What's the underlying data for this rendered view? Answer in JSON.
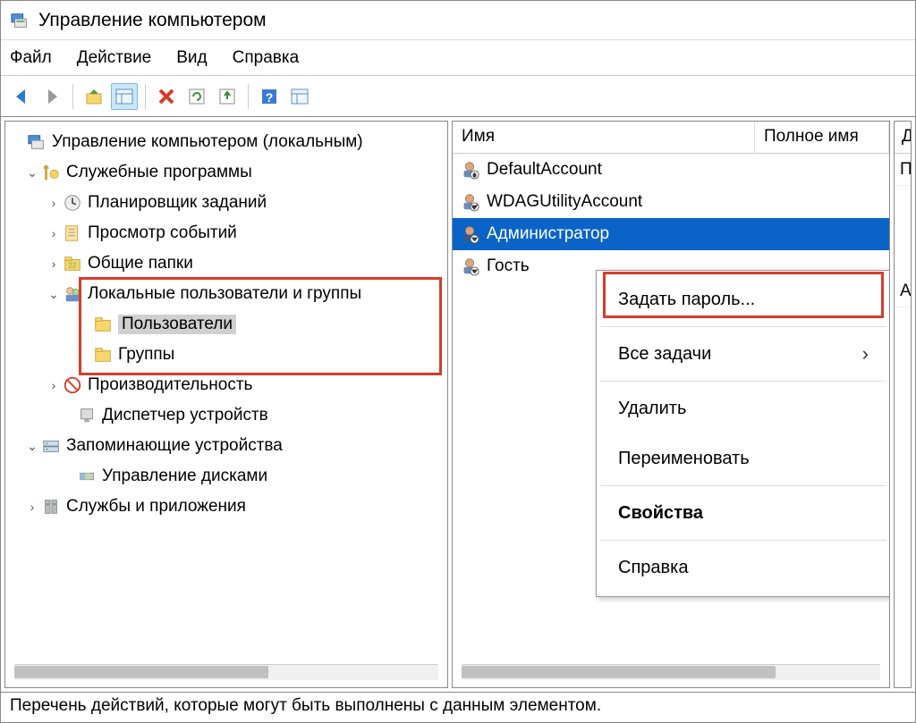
{
  "window": {
    "title": "Управление компьютером"
  },
  "menubar": [
    "Файл",
    "Действие",
    "Вид",
    "Справка"
  ],
  "tree": {
    "root": "Управление компьютером (локальным)",
    "utilities": "Служебные программы",
    "task_scheduler": "Планировщик заданий",
    "event_viewer": "Просмотр событий",
    "shared_folders": "Общие папки",
    "local_users_groups": "Локальные пользователи и группы",
    "users": "Пользователи",
    "groups": "Группы",
    "performance": "Производительность",
    "device_manager": "Диспетчер устройств",
    "storage": "Запоминающие устройства",
    "disk_management": "Управление дисками",
    "services_apps": "Службы и приложения"
  },
  "list": {
    "col_name": "Имя",
    "col_full": "Полное имя",
    "rows": [
      {
        "name": "DefaultAccount"
      },
      {
        "name": "WDAGUtilityAccount"
      },
      {
        "name": "Администратор",
        "selected": true
      },
      {
        "name": "Гость"
      }
    ]
  },
  "context_menu": {
    "set_password": "Задать пароль...",
    "all_tasks": "Все задачи",
    "delete": "Удалить",
    "rename": "Переименовать",
    "properties": "Свойства",
    "help": "Справка"
  },
  "right_pane": {
    "header_partial": "Д",
    "row_partial": "П",
    "row_partial2": "А"
  },
  "statusbar": "Перечень действий, которые могут быть выполнены с данным элементом."
}
